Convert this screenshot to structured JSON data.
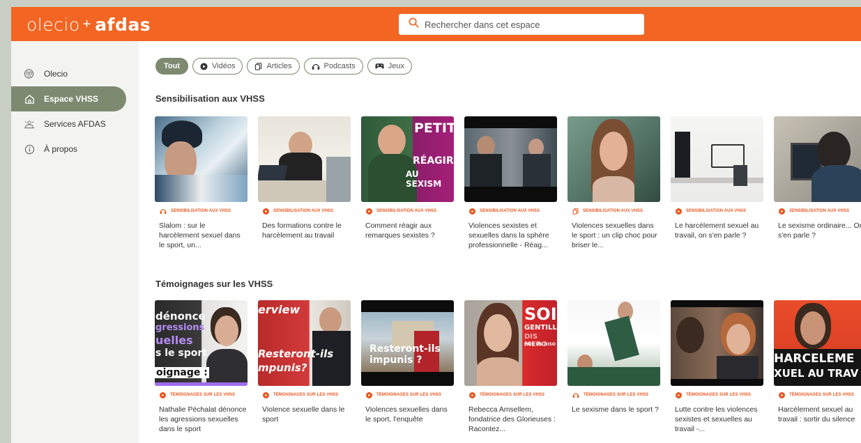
{
  "header": {
    "logo_olecio": "olecio",
    "logo_plus": "+",
    "logo_afdas": "afdas",
    "search_placeholder": "Rechercher dans cet espace"
  },
  "sidebar": {
    "items": [
      {
        "label": "Olecio",
        "icon": "olecio-logo-icon",
        "active": false
      },
      {
        "label": "Espace VHSS",
        "icon": "home-icon",
        "active": true
      },
      {
        "label": "Services AFDAS",
        "icon": "services-icon",
        "active": false
      },
      {
        "label": "À propos",
        "icon": "info-icon",
        "active": false
      }
    ]
  },
  "filters": [
    {
      "label": "Tout",
      "icon": "",
      "active": true
    },
    {
      "label": "Vidéos",
      "icon": "play-icon",
      "active": false
    },
    {
      "label": "Articles",
      "icon": "article-icon",
      "active": false
    },
    {
      "label": "Podcasts",
      "icon": "headphones-icon",
      "active": false
    },
    {
      "label": "Jeux",
      "icon": "gamepad-icon",
      "active": false
    }
  ],
  "sections": [
    {
      "title": "Sensibilisation aux VHSS",
      "cards": [
        {
          "category": "SENSIBILISATION AUX VHSS",
          "type": "podcast",
          "title": "Slalom : sur le harcèlement sexuel dans le sport, un...",
          "overlay": ""
        },
        {
          "category": "SENSIBILISATION AUX VHSS",
          "type": "video",
          "title": "Des formations contre le harcèlement au travail",
          "overlay": ""
        },
        {
          "category": "SENSIBILISATION AUX VHSS",
          "type": "video",
          "title": "Comment réagir aux remarques sexistes ?",
          "overlay": "PETIT RÉAGIR AU SEXISM"
        },
        {
          "category": "SENSIBILISATION AUX VHSS",
          "type": "video",
          "title": "Violences sexistes et sexuelles dans la sphère professionnelle - Réag...",
          "overlay": ""
        },
        {
          "category": "SENSIBILISATION AUX VHSS",
          "type": "article",
          "title": "Violences sexuelles dans le sport : un clip choc pour briser le...",
          "overlay": ""
        },
        {
          "category": "SENSIBILISATION AUX VHSS",
          "type": "video",
          "title": "Le harcèlement sexuel au travail, on s'en parle ?",
          "overlay": ""
        },
        {
          "category": "SENSIBILISATION AUX VHSS",
          "type": "video",
          "title": "Le sexisme ordinaire... On s'en parle ?",
          "overlay": ""
        }
      ]
    },
    {
      "title": "Témoignages sur les VHSS",
      "cards": [
        {
          "category": "TÉMOIGNAGES SUR LES VHSS",
          "type": "video",
          "title": "Nathalie Péchalat dénonce les agressions sexuelles dans le sport",
          "overlay": "dénonce agressions uelles s le sport oignage :"
        },
        {
          "category": "TÉMOIGNAGES SUR LES VHSS",
          "type": "video",
          "title": "Violence sexuelle dans le sport",
          "overlay": "erview Resteront-ils mpunis?"
        },
        {
          "category": "TÉMOIGNAGES SUR LES VHSS",
          "type": "video",
          "title": "Violences sexuelles dans le sport, l'enquête",
          "overlay": "Resteront-ils impunis ?"
        },
        {
          "category": "TÉMOIGNAGES SUR LES VHSS",
          "type": "video",
          "title": "Rebecca Amsellem, fondatrice des Glorieuses : Racontez...",
          "overlay": "SOIS GENTILL DIS MERC FAIS UN BISO"
        },
        {
          "category": "TÉMOIGNAGES SUR LES VHSS",
          "type": "podcast",
          "title": "Le sexisme dans le sport ?",
          "overlay": ""
        },
        {
          "category": "TÉMOIGNAGES SUR LES VHSS",
          "type": "video",
          "title": "Lutte contre les violences sexistes et sexuelles au travail -...",
          "overlay": ""
        },
        {
          "category": "TÉMOIGNAGES SUR LES VHSS",
          "type": "video",
          "title": "Harcèlement sexuel au travail : sortir du silence",
          "overlay": "HARCELEME XUEL AU TRAV"
        }
      ]
    }
  ],
  "colors": {
    "brand": "#f26522",
    "accent": "#7d8a70",
    "category": "#e8561e"
  }
}
